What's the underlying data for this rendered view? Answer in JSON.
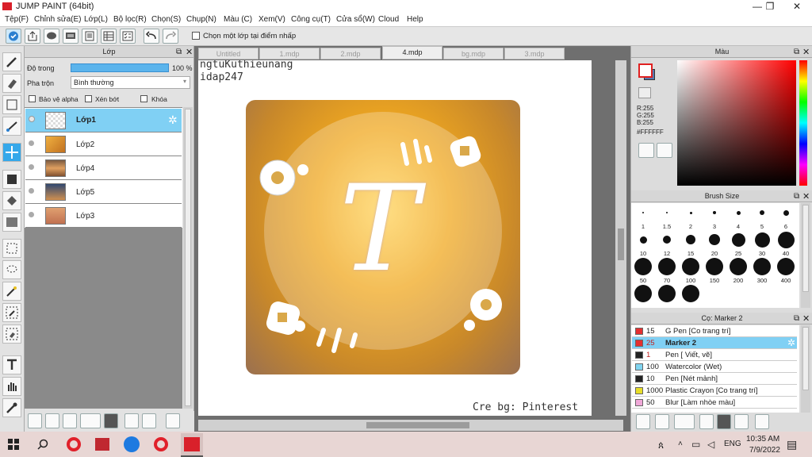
{
  "window": {
    "title": "JUMP PAINT (64bit)",
    "min": "—",
    "max": "❐",
    "close": "✕"
  },
  "menu": [
    "Tệp(F)",
    "Chỉnh sửa(E)",
    "Lớp(L)",
    "Bộ lọc(R)",
    "Chọn(S)",
    "Chụp(N)",
    "Màu (C)",
    "Xem(V)",
    "Công cụ(T)",
    "Cửa sổ(W)",
    "Cloud",
    "Help"
  ],
  "toolbar": {
    "checkbox_label": "Chọn một lớp tại điểm nhấp"
  },
  "layers": {
    "title": "Lớp",
    "opacity_label": "Độ trong",
    "opacity_value": "100 %",
    "opacity_fraction": 1.0,
    "blend_label": "Pha trộn",
    "blend_value": "Bình thường",
    "protect_alpha": "Bảo vệ alpha",
    "clipping": "Xén bớt",
    "lock": "Khóa",
    "items": [
      {
        "name": "Lớp1",
        "selected": true
      },
      {
        "name": "Lớp2"
      },
      {
        "name": "Lớp4"
      },
      {
        "name": "Lớp5"
      },
      {
        "name": "Lớp3"
      }
    ]
  },
  "tabs": [
    {
      "label": "Untitled"
    },
    {
      "label": "1.mdp"
    },
    {
      "label": "2.mdp"
    },
    {
      "label": "4.mdp",
      "active": true
    },
    {
      "label": "bg.mdp"
    },
    {
      "label": "3.mdp"
    }
  ],
  "canvas": {
    "text1": "ngtuKuthieunang",
    "text2": "idap247",
    "credit": "Cre bg: Pinterest",
    "letter": "T"
  },
  "color_panel": {
    "title": "Màu",
    "r": "R:255",
    "g": "G:255",
    "b": "B:255",
    "hex": "#FFFFFF"
  },
  "brush_size": {
    "title": "Brush Size",
    "sizes": [
      "1",
      "1.5",
      "2",
      "3",
      "4",
      "5",
      "6",
      "10",
      "12",
      "15",
      "20",
      "25",
      "30",
      "40",
      "50",
      "70",
      "100",
      "150",
      "200",
      "300",
      "400",
      "",
      "",
      " "
    ]
  },
  "brush_list": {
    "title": "Cọ: Marker 2",
    "items": [
      {
        "size": "15",
        "name": "G Pen [Co trang trí]",
        "color": "#e53030"
      },
      {
        "size": "25",
        "name": "Marker 2",
        "color": "#e53030",
        "selected": true
      },
      {
        "size": "1",
        "name": "Pen [ Viết, vẽ]",
        "color": "#222222"
      },
      {
        "size": "100",
        "name": "Watercolor (Wet)",
        "color": "#7fd4f0"
      },
      {
        "size": "10",
        "name": "Pen [Nét mảnh]",
        "color": "#222222"
      },
      {
        "size": "1000",
        "name": "Plastic Crayon [Co trang trí]",
        "color": "#e8de28"
      },
      {
        "size": "50",
        "name": "Blur [Làm nhòe màu]",
        "color": "#f0a8d8"
      }
    ]
  },
  "taskbar": {
    "lang": "ENG",
    "time": "10:35 AM",
    "date": "7/9/2022"
  }
}
